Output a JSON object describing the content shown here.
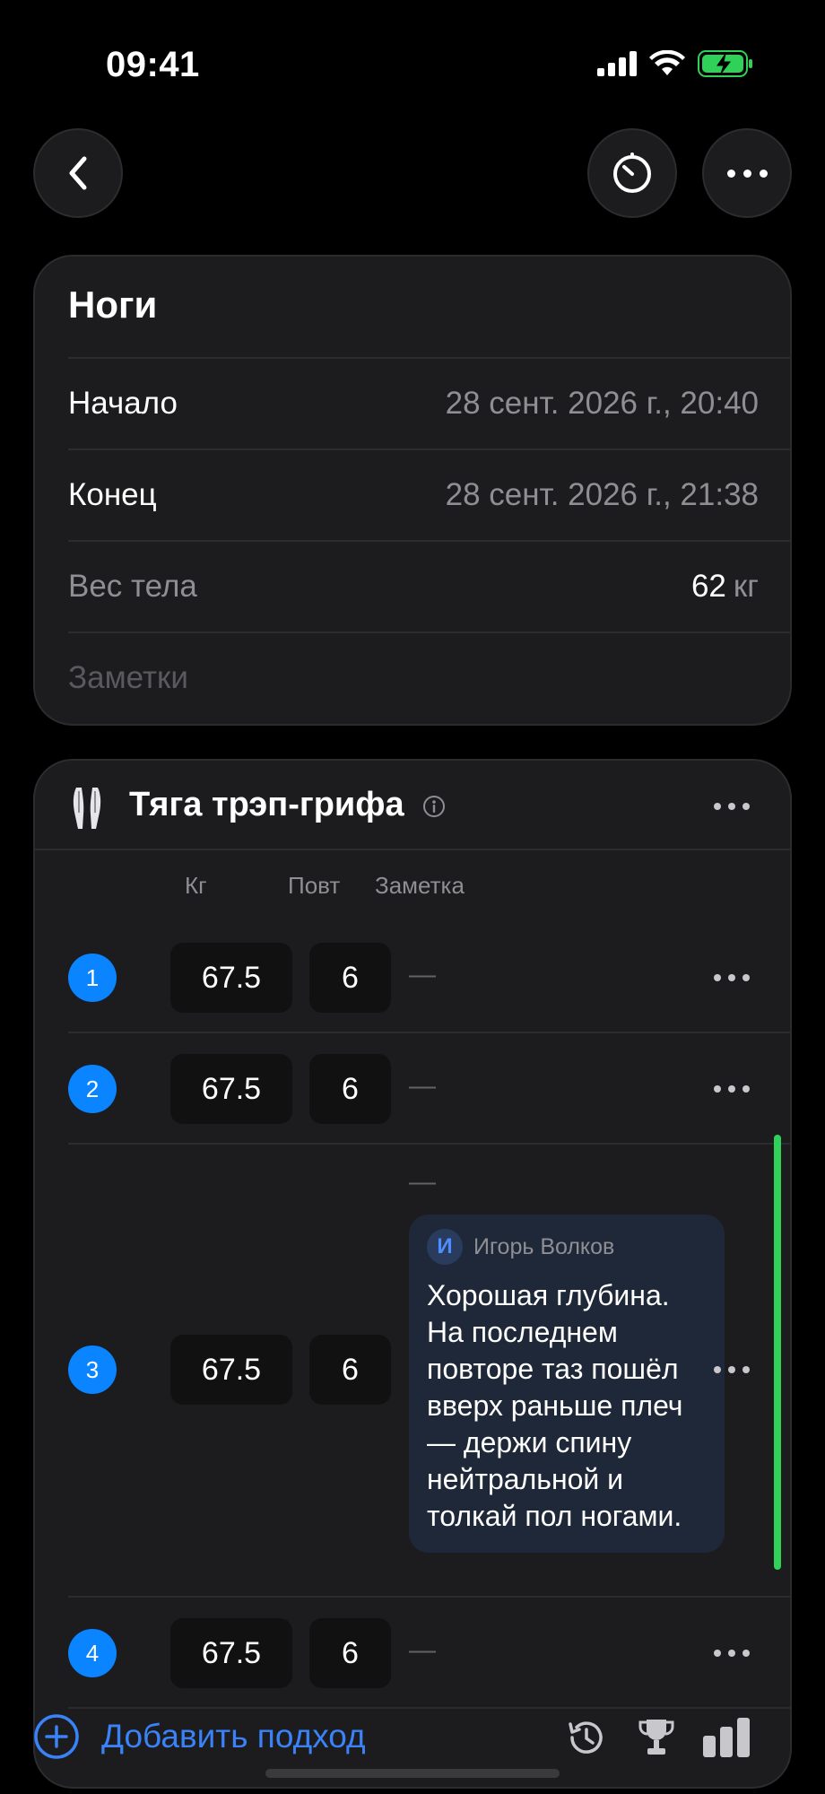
{
  "status_bar": {
    "time": "09:41"
  },
  "workout": {
    "title": "Ноги",
    "start_label": "Начало",
    "start_value": "28 сент. 2026 г., 20:40",
    "end_label": "Конец",
    "end_value": "28 сент. 2026 г., 21:38",
    "bodyweight_label": "Вес тела",
    "bodyweight_value": "62",
    "bodyweight_unit": "кг",
    "notes_placeholder": "Заметки"
  },
  "exercise": {
    "name": "Тяга трэп-грифа",
    "columns": {
      "kg": "Кг",
      "reps": "Повт",
      "note": "Заметка"
    },
    "sets": [
      {
        "num": "1",
        "kg": "67.5",
        "reps": "6",
        "note": "—"
      },
      {
        "num": "2",
        "kg": "67.5",
        "reps": "6",
        "note": "—"
      },
      {
        "num": "3",
        "kg": "67.5",
        "reps": "6",
        "note": "—",
        "comment": {
          "avatar_letter": "И",
          "author": "Игорь Волков",
          "text": "Хорошая глубина. На последнем повторе таз пошёл вверх раньше плеч — держи спину нейтральной и толкай пол ногами."
        }
      },
      {
        "num": "4",
        "kg": "67.5",
        "reps": "6",
        "note": "—"
      }
    ],
    "add_set_label": "Добавить подход"
  },
  "colors": {
    "accent": "#0a84ff",
    "link": "#3a82f7",
    "highlight": "#30d158",
    "card": "#1c1c1e"
  },
  "icons": [
    "back-icon",
    "timer-icon",
    "more-icon",
    "muscle-icon",
    "info-icon",
    "plus-circle-icon",
    "history-icon",
    "trophy-icon",
    "stats-icon"
  ]
}
